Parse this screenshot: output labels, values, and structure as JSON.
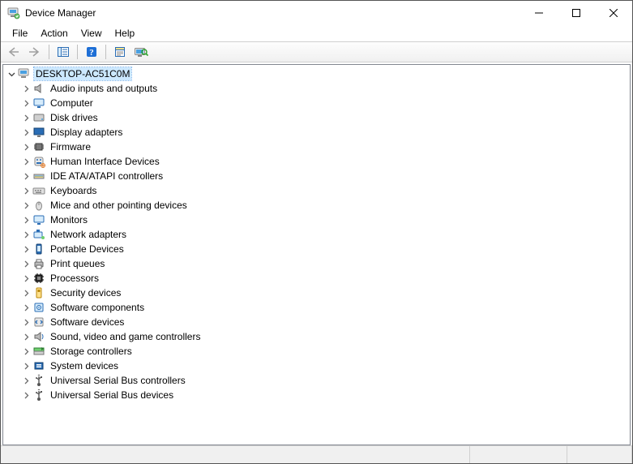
{
  "window": {
    "title": "Device Manager"
  },
  "menubar": {
    "items": [
      "File",
      "Action",
      "View",
      "Help"
    ]
  },
  "toolbar": {
    "buttons": [
      {
        "name": "back-button",
        "icon": "arrow-left",
        "enabled": false
      },
      {
        "name": "forward-button",
        "icon": "arrow-right",
        "enabled": false
      },
      {
        "name": "sep"
      },
      {
        "name": "show-hide-console-tree-button",
        "icon": "console-tree",
        "enabled": true
      },
      {
        "name": "sep"
      },
      {
        "name": "help-button",
        "icon": "help",
        "enabled": true
      },
      {
        "name": "sep"
      },
      {
        "name": "properties-button",
        "icon": "properties",
        "enabled": true
      },
      {
        "name": "scan-hardware-button",
        "icon": "scan-hardware",
        "enabled": true
      }
    ]
  },
  "tree": {
    "root": {
      "label": "DESKTOP-AC51C0M",
      "icon": "computer",
      "expanded": true,
      "selected": true
    },
    "categories": [
      {
        "label": "Audio inputs and outputs",
        "icon": "audio"
      },
      {
        "label": "Computer",
        "icon": "computer-monitor"
      },
      {
        "label": "Disk drives",
        "icon": "disk"
      },
      {
        "label": "Display adapters",
        "icon": "display"
      },
      {
        "label": "Firmware",
        "icon": "chip"
      },
      {
        "label": "Human Interface Devices",
        "icon": "hid"
      },
      {
        "label": "IDE ATA/ATAPI controllers",
        "icon": "ide"
      },
      {
        "label": "Keyboards",
        "icon": "keyboard"
      },
      {
        "label": "Mice and other pointing devices",
        "icon": "mouse"
      },
      {
        "label": "Monitors",
        "icon": "monitor"
      },
      {
        "label": "Network adapters",
        "icon": "network"
      },
      {
        "label": "Portable Devices",
        "icon": "portable"
      },
      {
        "label": "Print queues",
        "icon": "printer"
      },
      {
        "label": "Processors",
        "icon": "cpu"
      },
      {
        "label": "Security devices",
        "icon": "security"
      },
      {
        "label": "Software components",
        "icon": "software-comp"
      },
      {
        "label": "Software devices",
        "icon": "software-dev"
      },
      {
        "label": "Sound, video and game controllers",
        "icon": "sound-video"
      },
      {
        "label": "Storage controllers",
        "icon": "storage"
      },
      {
        "label": "System devices",
        "icon": "system"
      },
      {
        "label": "Universal Serial Bus controllers",
        "icon": "usb"
      },
      {
        "label": "Universal Serial Bus devices",
        "icon": "usb"
      }
    ]
  }
}
